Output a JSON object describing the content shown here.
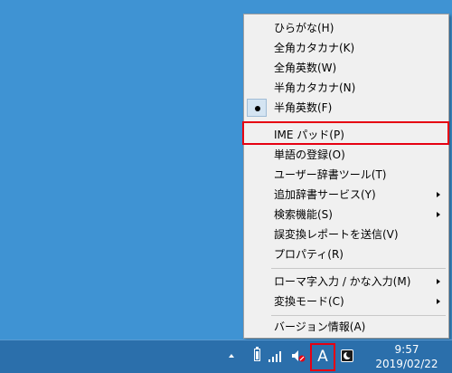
{
  "menu": {
    "items": [
      {
        "label": "ひらがな(H)",
        "checked": false,
        "submenu": false
      },
      {
        "label": "全角カタカナ(K)",
        "checked": false,
        "submenu": false
      },
      {
        "label": "全角英数(W)",
        "checked": false,
        "submenu": false
      },
      {
        "label": "半角カタカナ(N)",
        "checked": false,
        "submenu": false
      },
      {
        "label": "半角英数(F)",
        "checked": true,
        "submenu": false
      },
      {
        "label": "IME パッド(P)",
        "checked": false,
        "submenu": false,
        "highlighted": true
      },
      {
        "label": "単語の登録(O)",
        "checked": false,
        "submenu": false
      },
      {
        "label": "ユーザー辞書ツール(T)",
        "checked": false,
        "submenu": false
      },
      {
        "label": "追加辞書サービス(Y)",
        "checked": false,
        "submenu": true
      },
      {
        "label": "検索機能(S)",
        "checked": false,
        "submenu": true
      },
      {
        "label": "誤変換レポートを送信(V)",
        "checked": false,
        "submenu": false
      },
      {
        "label": "プロパティ(R)",
        "checked": false,
        "submenu": false
      },
      {
        "label": "ローマ字入力 / かな入力(M)",
        "checked": false,
        "submenu": true
      },
      {
        "label": "変換モード(C)",
        "checked": false,
        "submenu": true
      },
      {
        "label": "バージョン情報(A)",
        "checked": false,
        "submenu": false
      }
    ]
  },
  "taskbar": {
    "ime_indicator": "A",
    "clock_time": "9:57",
    "clock_date": "2019/02/22"
  },
  "icons": {
    "tray_overflow": "chevron-up-icon",
    "battery": "battery-icon",
    "signal": "signal-icon",
    "volume": "volume-muted-icon",
    "ime_pad": "ime-pad-icon"
  },
  "colors": {
    "desktop": "#3f93d3",
    "taskbar": "#2b6fab",
    "highlight_border": "#e60012",
    "menu_background": "#f0f0f0"
  }
}
